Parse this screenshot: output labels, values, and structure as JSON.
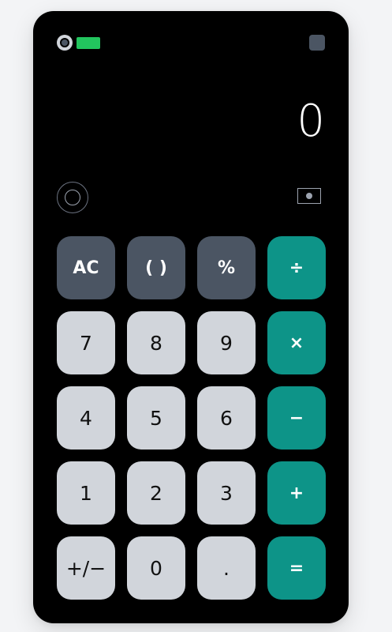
{
  "status": {
    "battery_color": "#22c55e",
    "left_icons": [
      "camera-dot-icon",
      "battery-icon"
    ],
    "right_icon": "square-icon"
  },
  "display": {
    "value": "0"
  },
  "tools": {
    "left_icon": "history-icon",
    "right_icon": "camera-icon"
  },
  "keys": {
    "ac": "AC",
    "parens": "( )",
    "percent": "%",
    "divide": "÷",
    "seven": "7",
    "eight": "8",
    "nine": "9",
    "multiply": "×",
    "four": "4",
    "five": "5",
    "six": "6",
    "minus": "−",
    "one": "1",
    "two": "2",
    "three": "3",
    "plus": "+",
    "sign": "+/−",
    "zero": "0",
    "dot": ".",
    "equals": "="
  },
  "colors": {
    "function_key": "#4b5563",
    "number_key": "#d1d5db",
    "operator_key": "#0d9488",
    "screen": "#000000"
  }
}
